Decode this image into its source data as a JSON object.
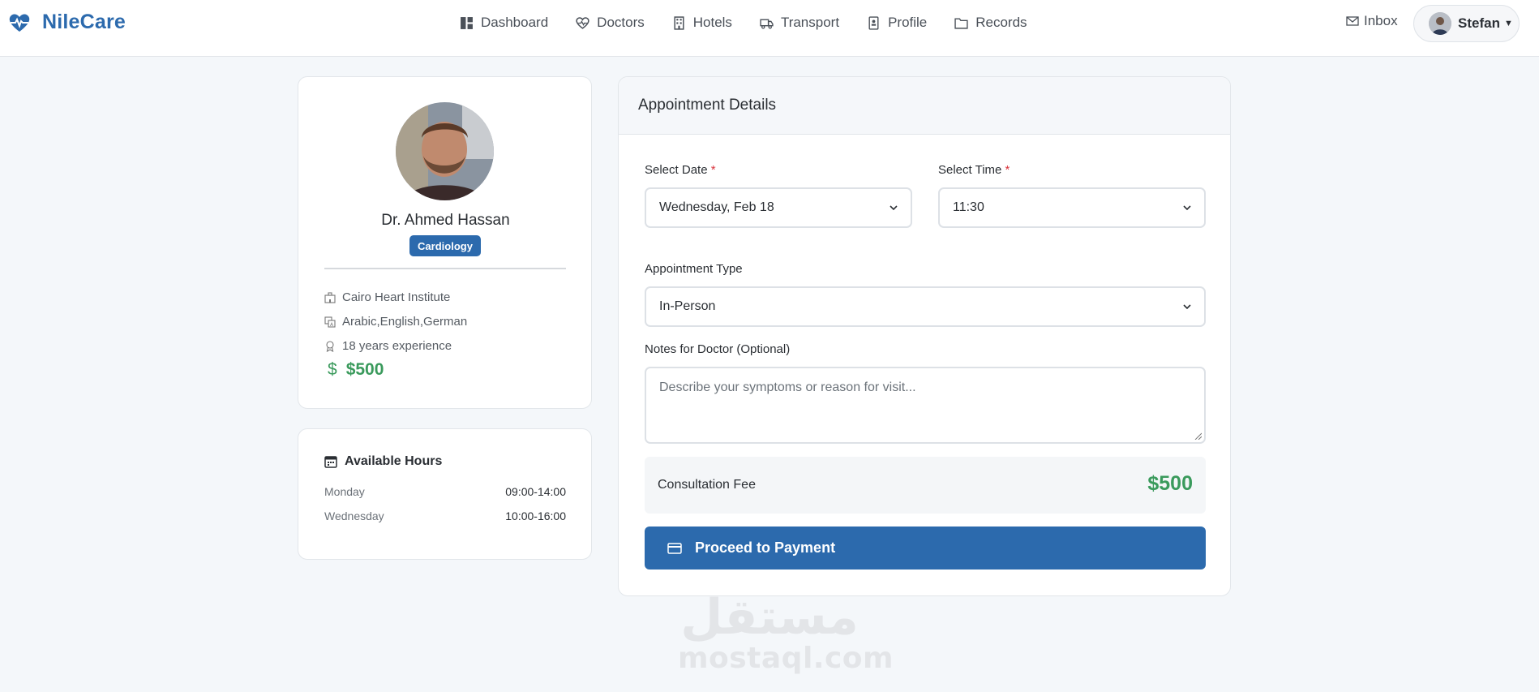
{
  "brand": {
    "name": "NileCare",
    "color": "#2c6aad"
  },
  "nav": {
    "links": [
      {
        "label": "Dashboard",
        "icon": "dashboard-icon"
      },
      {
        "label": "Doctors",
        "icon": "heart-pulse-icon"
      },
      {
        "label": "Hotels",
        "icon": "building-icon"
      },
      {
        "label": "Transport",
        "icon": "truck-icon"
      },
      {
        "label": "Profile",
        "icon": "profile-icon"
      },
      {
        "label": "Records",
        "icon": "folder-icon"
      }
    ],
    "inbox": "Inbox",
    "user": "Stefan"
  },
  "doctor": {
    "name": "Dr. Ahmed Hassan",
    "specialty": "Cardiology",
    "hospital": "Cairo Heart Institute",
    "languages": "Arabic,English,German",
    "experience": "18 years experience",
    "currency_symbol": "$",
    "price": "$500"
  },
  "hours": {
    "title": "Available Hours",
    "rows": [
      {
        "day": "Monday",
        "time": "09:00-14:00"
      },
      {
        "day": "Wednesday",
        "time": "10:00-16:00"
      }
    ]
  },
  "appointment": {
    "title": "Appointment Details",
    "date_label": "Select Date",
    "date_value": "Wednesday, Feb 18",
    "time_label": "Select Time",
    "time_value": "11:30",
    "type_label": "Appointment Type",
    "type_value": "In-Person",
    "notes_label": "Notes for Doctor (Optional)",
    "notes_placeholder": "Describe your symptoms or reason for visit...",
    "fee_label": "Consultation Fee",
    "fee_value": "$500",
    "pay_label": "Proceed to Payment",
    "required_marker": "*"
  },
  "watermark": {
    "arabic": "مستقل",
    "latin": "mostaql.com"
  },
  "colors": {
    "accent": "#2c6aad",
    "price": "#3a9a5c",
    "required": "#d9363e"
  }
}
